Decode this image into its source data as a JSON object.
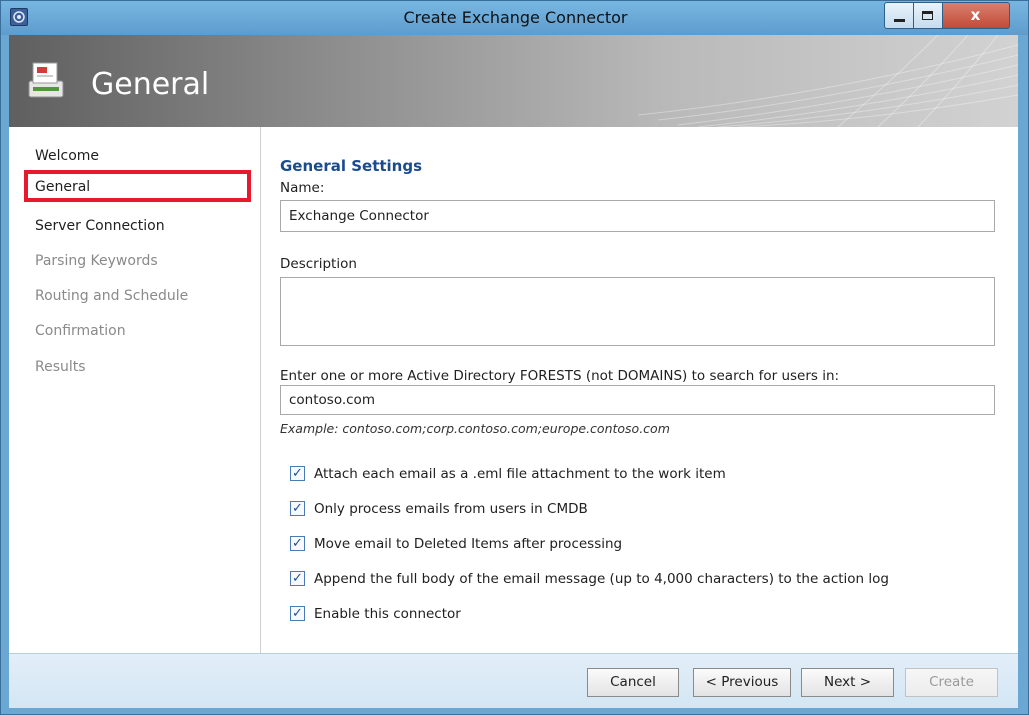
{
  "window": {
    "title": "Create Exchange Connector",
    "close_glyph": "x"
  },
  "banner": {
    "title": "General",
    "icon": "exchange-connector-icon"
  },
  "nav": {
    "items": [
      {
        "label": "Welcome",
        "enabled": true
      },
      {
        "label": "General",
        "enabled": true,
        "selected": true
      },
      {
        "label": "Server Connection",
        "enabled": true
      },
      {
        "label": "Parsing Keywords",
        "enabled": false
      },
      {
        "label": "Routing and Schedule",
        "enabled": false
      },
      {
        "label": "Confirmation",
        "enabled": false
      },
      {
        "label": "Results",
        "enabled": false
      }
    ],
    "highlight_color": "#e8192c"
  },
  "general": {
    "section_title": "General Settings",
    "name_label": "Name:",
    "name_value": "Exchange Connector",
    "description_label": "Description",
    "description_value": "",
    "forests_label": "Enter one or more Active Directory FORESTS (not DOMAINS) to search for users in:",
    "forests_value": "contoso.com",
    "forests_example": "Example: contoso.com;corp.contoso.com;europe.contoso.com",
    "options": [
      {
        "label": "Attach each email as a .eml file attachment to the work item",
        "checked": true
      },
      {
        "label": "Only process emails from users in CMDB",
        "checked": true
      },
      {
        "label": "Move email to Deleted Items after processing",
        "checked": true
      },
      {
        "label": "Append the full body of the email message (up to 4,000 characters) to the action log",
        "checked": true
      },
      {
        "label": "Enable this connector",
        "checked": true
      }
    ]
  },
  "footer": {
    "cancel": "Cancel",
    "previous": "< Previous",
    "next": "Next >",
    "create": "Create"
  },
  "colors": {
    "title_bar": "#6aa7d3",
    "section_title": "#1b4b8f",
    "close_button": "#c24a37"
  }
}
